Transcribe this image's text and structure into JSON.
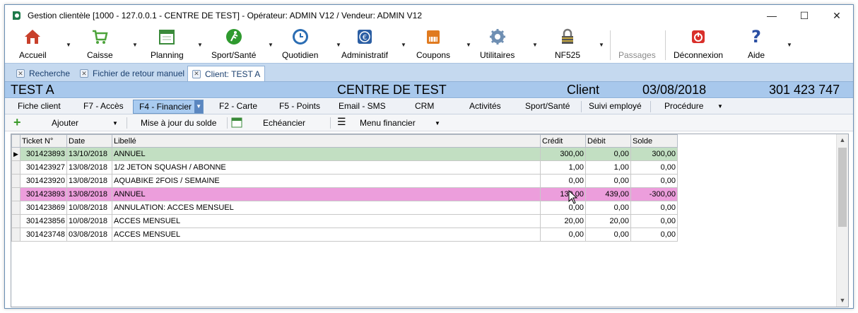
{
  "window": {
    "title": "Gestion clientèle [1000 - 127.0.0.1 - CENTRE DE TEST] - Opérateur: ADMIN V12 / Vendeur: ADMIN V12",
    "controls": {
      "minimize": "—",
      "maximize": "☐",
      "close": "✕"
    }
  },
  "toolbar": {
    "items": [
      {
        "label": "Accueil",
        "icon": "home-icon",
        "color": "#c8402b"
      },
      {
        "label": "Caisse",
        "icon": "cart-icon",
        "color": "#4ca33a"
      },
      {
        "label": "Planning",
        "icon": "calendar-icon",
        "color": "#3a8a3a"
      },
      {
        "label": "Sport/Santé",
        "icon": "runner-icon",
        "color": "#2f9a2f"
      },
      {
        "label": "Quotidien",
        "icon": "clock-icon",
        "color": "#2b6db3"
      },
      {
        "label": "Administratif",
        "icon": "euro-icon",
        "color": "#2b5ea3"
      },
      {
        "label": "Coupons",
        "icon": "coupon-icon",
        "color": "#e07a1f"
      },
      {
        "label": "Utilitaires",
        "icon": "gear-icon",
        "color": "#6f8fb3"
      },
      {
        "label": "NF525",
        "icon": "lock-icon",
        "color": "#555555"
      },
      {
        "label": "Passages",
        "icon": "",
        "color": "#8a8a8a"
      },
      {
        "label": "Déconnexion",
        "icon": "power-icon",
        "color": "#d9302b"
      },
      {
        "label": "Aide",
        "icon": "help-icon",
        "color": "#2b4fa3"
      }
    ]
  },
  "doc_tabs": [
    {
      "label": "Recherche"
    },
    {
      "label": "Fichier de retour manuel"
    },
    {
      "label": "Client: TEST A"
    }
  ],
  "client_header": {
    "name": "TEST A",
    "center": "CENTRE DE TEST",
    "type": "Client",
    "date": "03/08/2018",
    "phone": "301 423 747"
  },
  "sub_tabs": [
    {
      "label": "Fiche client"
    },
    {
      "label": "F7 - Accès"
    },
    {
      "label": "F4 - Financier"
    },
    {
      "label": "F2 - Carte"
    },
    {
      "label": "F5 - Points"
    },
    {
      "label": "Email - SMS"
    },
    {
      "label": "CRM"
    },
    {
      "label": "Activités"
    },
    {
      "label": "Sport/Santé"
    },
    {
      "label": "Suivi employé"
    },
    {
      "label": "Procédure"
    }
  ],
  "action_bar": {
    "add": "Ajouter",
    "update_balance": "Mise à jour du solde",
    "schedule": "Echéancier",
    "menu": "Menu financier"
  },
  "grid": {
    "columns": [
      "Ticket N°",
      "Date",
      "Libellé",
      "Crédit",
      "Débit",
      "Solde"
    ],
    "rows": [
      {
        "ticket": "301423893",
        "date": "13/10/2018",
        "label": "ANNUEL",
        "credit": "300,00",
        "debit": "0,00",
        "balance": "300,00",
        "highlight": "green"
      },
      {
        "ticket": "301423927",
        "date": "13/08/2018",
        "label": "1/2 JETON SQUASH / ABONNE",
        "credit": "1,00",
        "debit": "1,00",
        "balance": "0,00",
        "highlight": ""
      },
      {
        "ticket": "301423920",
        "date": "13/08/2018",
        "label": "AQUABIKE 2FOIS / SEMAINE",
        "credit": "0,00",
        "debit": "0,00",
        "balance": "0,00",
        "highlight": ""
      },
      {
        "ticket": "301423893",
        "date": "13/08/2018",
        "label": "ANNUEL",
        "credit": "139,00",
        "debit": "439,00",
        "balance": "-300,00",
        "highlight": "pink"
      },
      {
        "ticket": "301423869",
        "date": "10/08/2018",
        "label": "ANNULATION: ACCES MENSUEL",
        "credit": "0,00",
        "debit": "0,00",
        "balance": "0,00",
        "highlight": ""
      },
      {
        "ticket": "301423856",
        "date": "10/08/2018",
        "label": "ACCES MENSUEL",
        "credit": "20,00",
        "debit": "20,00",
        "balance": "0,00",
        "highlight": ""
      },
      {
        "ticket": "301423748",
        "date": "03/08/2018",
        "label": "ACCES MENSUEL",
        "credit": "0,00",
        "debit": "0,00",
        "balance": "0,00",
        "highlight": ""
      }
    ]
  }
}
